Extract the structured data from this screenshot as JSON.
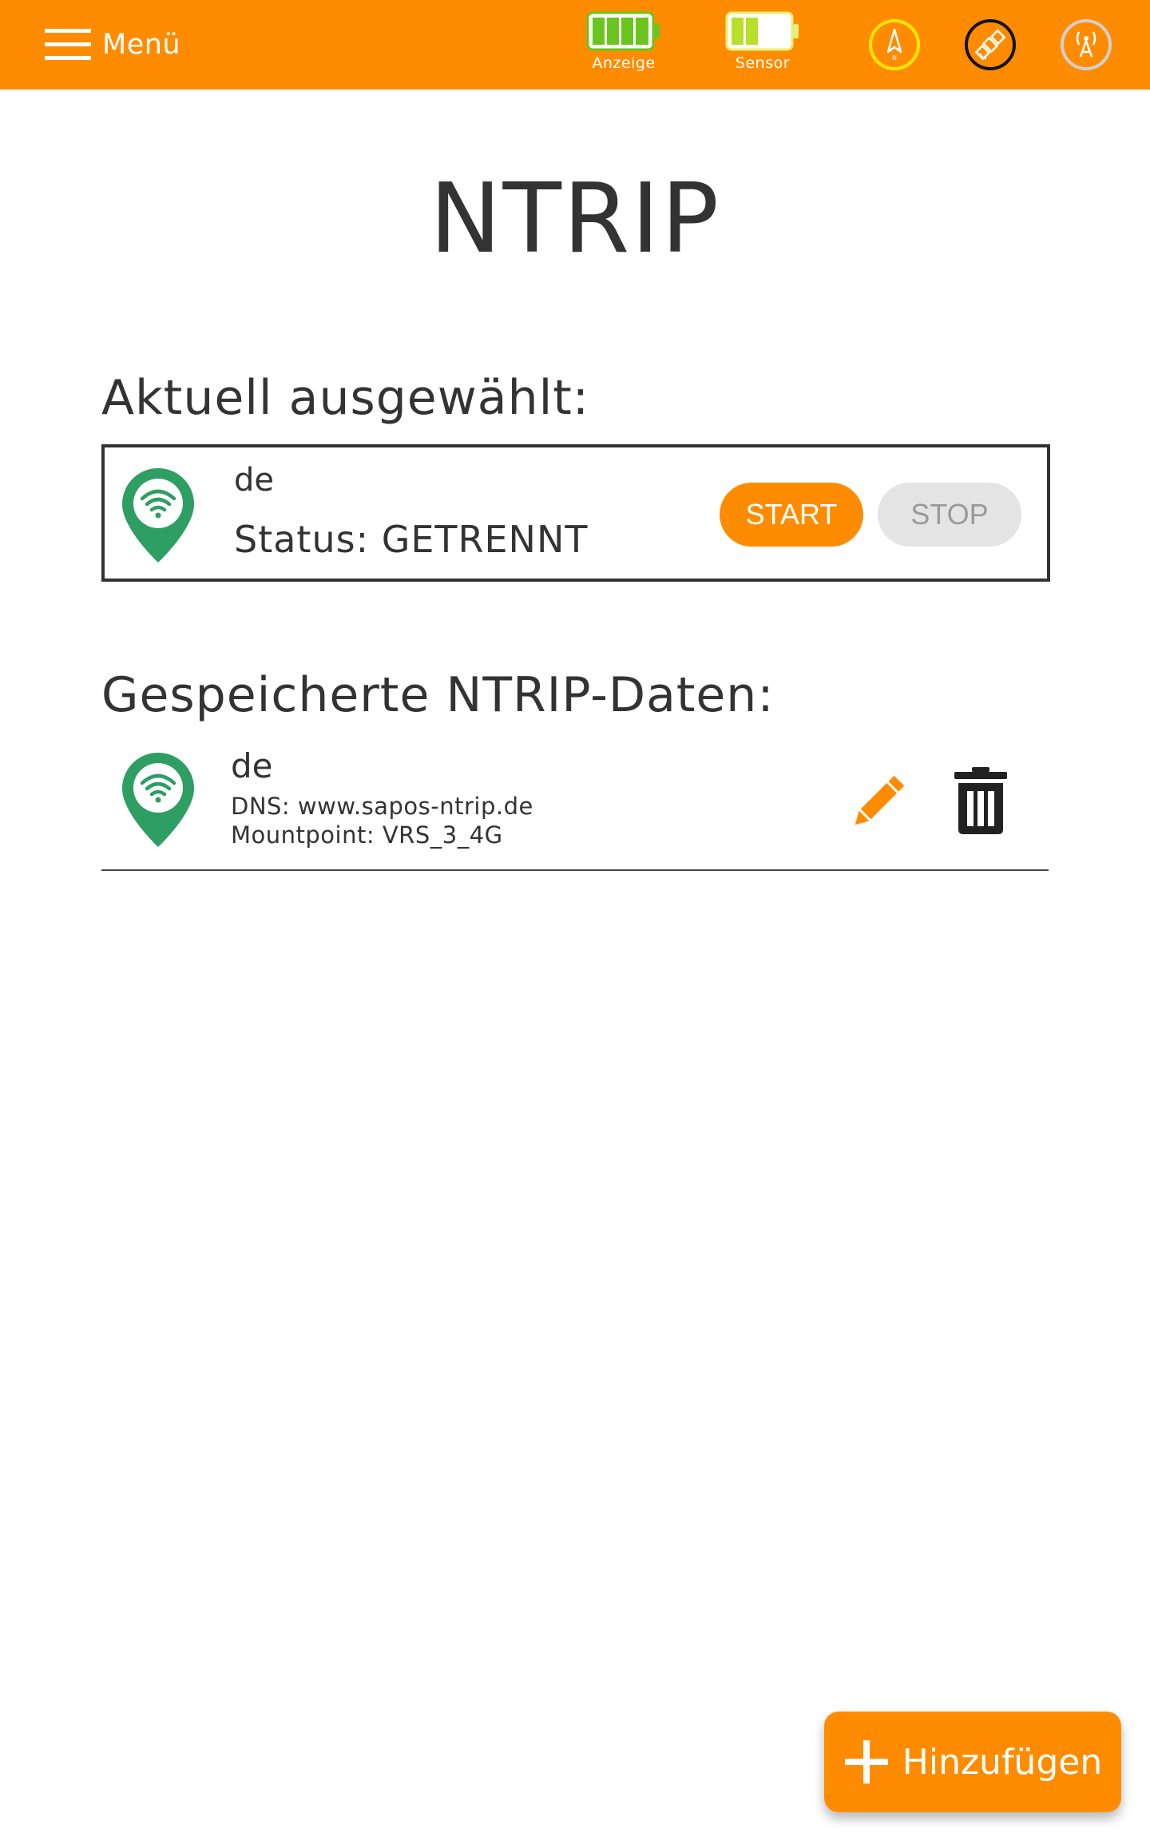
{
  "topbar": {
    "menu_label": "Menü",
    "battery_display_label": "Anzeige",
    "battery_sensor_label": "Sensor",
    "battery_display_level": 1.0,
    "battery_sensor_level": 0.5,
    "icons": [
      "compass-icon",
      "satellite-icon",
      "antenna-icon"
    ],
    "accent_color": "#FF8C00"
  },
  "page": {
    "title": "NTRIP"
  },
  "current": {
    "heading": "Aktuell ausgewählt:",
    "name": "de",
    "status": "Status: GETRENNT",
    "start_label": "START",
    "stop_label": "STOP"
  },
  "saved": {
    "heading": "Gespeicherte NTRIP-Daten:",
    "items": [
      {
        "name": "de",
        "dns": "DNS: www.sapos-ntrip.de",
        "mountpoint": "Mountpoint: VRS_3_4G"
      }
    ]
  },
  "actions": {
    "add_label": "Hinzufügen"
  },
  "colors": {
    "accent": "#FF8C00",
    "pin_green": "#2E9E63",
    "text": "#333333"
  }
}
